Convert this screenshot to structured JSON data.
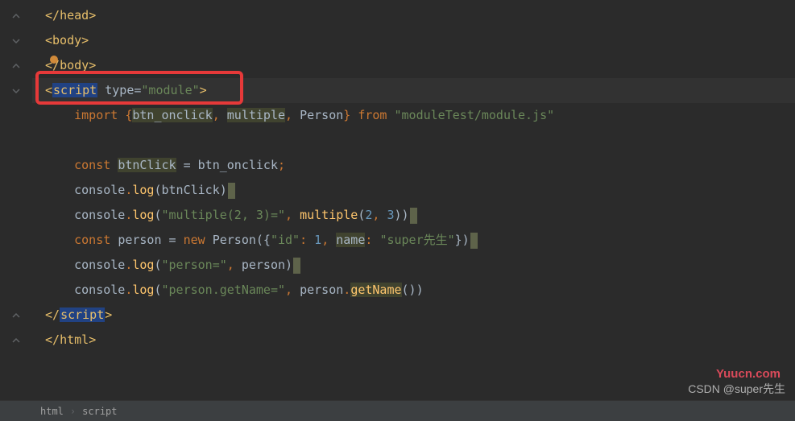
{
  "code": {
    "lines": [
      {
        "segments": [
          {
            "t": "</",
            "c": "tag-bracket"
          },
          {
            "t": "head",
            "c": "tag"
          },
          {
            "t": ">",
            "c": "tag-bracket"
          }
        ]
      },
      {
        "segments": [
          {
            "t": "<",
            "c": "tag-bracket"
          },
          {
            "t": "body",
            "c": "tag"
          },
          {
            "t": ">",
            "c": "tag-bracket"
          }
        ]
      },
      {
        "segments": [
          {
            "t": "</",
            "c": "tag-bracket"
          },
          {
            "t": "body",
            "c": "tag"
          },
          {
            "t": ">",
            "c": "tag-bracket"
          }
        ]
      },
      {
        "highlighted": true,
        "segments": [
          {
            "t": "<",
            "c": "tag-bracket"
          },
          {
            "t": "script",
            "c": "tag script-hl"
          },
          {
            "t": " ",
            "c": ""
          },
          {
            "t": "type",
            "c": "attr"
          },
          {
            "t": "=",
            "c": "attr"
          },
          {
            "t": "\"module\"",
            "c": "attr-val"
          },
          {
            "t": ">",
            "c": "tag-bracket"
          }
        ]
      },
      {
        "indent": "    ",
        "segments": [
          {
            "t": "import ",
            "c": "kw"
          },
          {
            "t": "{",
            "c": "punct"
          },
          {
            "t": "btn_onclick",
            "c": "ident-hl"
          },
          {
            "t": ", ",
            "c": "punct"
          },
          {
            "t": "multiple",
            "c": "ident-hl"
          },
          {
            "t": ", ",
            "c": "punct"
          },
          {
            "t": "Person",
            "c": "ident"
          },
          {
            "t": "} ",
            "c": "punct"
          },
          {
            "t": "from ",
            "c": "kw"
          },
          {
            "t": "\"moduleTest/module.js\"",
            "c": "str"
          }
        ]
      },
      {
        "segments": []
      },
      {
        "indent": "    ",
        "segments": [
          {
            "t": "const ",
            "c": "kw"
          },
          {
            "t": "btnClick",
            "c": "ident-hl"
          },
          {
            "t": " = ",
            "c": "ident"
          },
          {
            "t": "btn_onclick",
            "c": "ident"
          },
          {
            "t": ";",
            "c": "punct"
          }
        ]
      },
      {
        "indent": "    ",
        "segments": [
          {
            "t": "console",
            "c": "obj"
          },
          {
            "t": ".",
            "c": "punct"
          },
          {
            "t": "log",
            "c": "fn"
          },
          {
            "t": "(",
            "c": "ident"
          },
          {
            "t": "btnClick",
            "c": "ident"
          },
          {
            "t": ")",
            "c": "ident"
          }
        ],
        "cursor": true
      },
      {
        "indent": "    ",
        "segments": [
          {
            "t": "console",
            "c": "obj"
          },
          {
            "t": ".",
            "c": "punct"
          },
          {
            "t": "log",
            "c": "fn"
          },
          {
            "t": "(",
            "c": "ident"
          },
          {
            "t": "\"multiple(2, 3)=\"",
            "c": "str"
          },
          {
            "t": ", ",
            "c": "punct"
          },
          {
            "t": "multiple",
            "c": "fn"
          },
          {
            "t": "(",
            "c": "ident"
          },
          {
            "t": "2",
            "c": "num"
          },
          {
            "t": ", ",
            "c": "punct"
          },
          {
            "t": "3",
            "c": "num"
          },
          {
            "t": "))",
            "c": "ident"
          }
        ],
        "cursor": true
      },
      {
        "indent": "    ",
        "segments": [
          {
            "t": "const ",
            "c": "kw"
          },
          {
            "t": "person",
            "c": "ident"
          },
          {
            "t": " = ",
            "c": "ident"
          },
          {
            "t": "new ",
            "c": "kw"
          },
          {
            "t": "Person",
            "c": "ident"
          },
          {
            "t": "({",
            "c": "ident"
          },
          {
            "t": "\"id\"",
            "c": "str"
          },
          {
            "t": ": ",
            "c": "punct"
          },
          {
            "t": "1",
            "c": "num"
          },
          {
            "t": ", ",
            "c": "punct"
          },
          {
            "t": "name",
            "c": "ident-hl"
          },
          {
            "t": ": ",
            "c": "punct"
          },
          {
            "t": "\"super先生\"",
            "c": "str"
          },
          {
            "t": "})",
            "c": "ident"
          }
        ],
        "cursor": true
      },
      {
        "indent": "    ",
        "segments": [
          {
            "t": "console",
            "c": "obj"
          },
          {
            "t": ".",
            "c": "punct"
          },
          {
            "t": "log",
            "c": "fn"
          },
          {
            "t": "(",
            "c": "ident"
          },
          {
            "t": "\"person=\"",
            "c": "str"
          },
          {
            "t": ", ",
            "c": "punct"
          },
          {
            "t": "person",
            "c": "ident"
          },
          {
            "t": ")",
            "c": "ident"
          }
        ],
        "cursor": true
      },
      {
        "indent": "    ",
        "segments": [
          {
            "t": "console",
            "c": "obj"
          },
          {
            "t": ".",
            "c": "punct"
          },
          {
            "t": "log",
            "c": "fn"
          },
          {
            "t": "(",
            "c": "ident"
          },
          {
            "t": "\"person.getName=\"",
            "c": "str"
          },
          {
            "t": ", ",
            "c": "punct"
          },
          {
            "t": "person",
            "c": "ident"
          },
          {
            "t": ".",
            "c": "punct"
          },
          {
            "t": "getName",
            "c": "fn method-hl"
          },
          {
            "t": "())",
            "c": "ident"
          }
        ]
      },
      {
        "segments": [
          {
            "t": "</",
            "c": "tag-bracket"
          },
          {
            "t": "script",
            "c": "tag script-hl"
          },
          {
            "t": ">",
            "c": "tag-bracket"
          }
        ]
      },
      {
        "segments": [
          {
            "t": "</",
            "c": "tag-bracket"
          },
          {
            "t": "html",
            "c": "tag"
          },
          {
            "t": ">",
            "c": "tag-bracket"
          }
        ]
      }
    ],
    "folds": [
      "up",
      "down",
      "up",
      "down",
      "",
      "",
      "",
      "",
      "",
      "",
      "",
      "",
      "up",
      "up"
    ]
  },
  "breadcrumb": {
    "items": [
      "html",
      "script"
    ]
  },
  "watermarks": {
    "site": "Yuucn.com",
    "author": "CSDN @super先生"
  }
}
